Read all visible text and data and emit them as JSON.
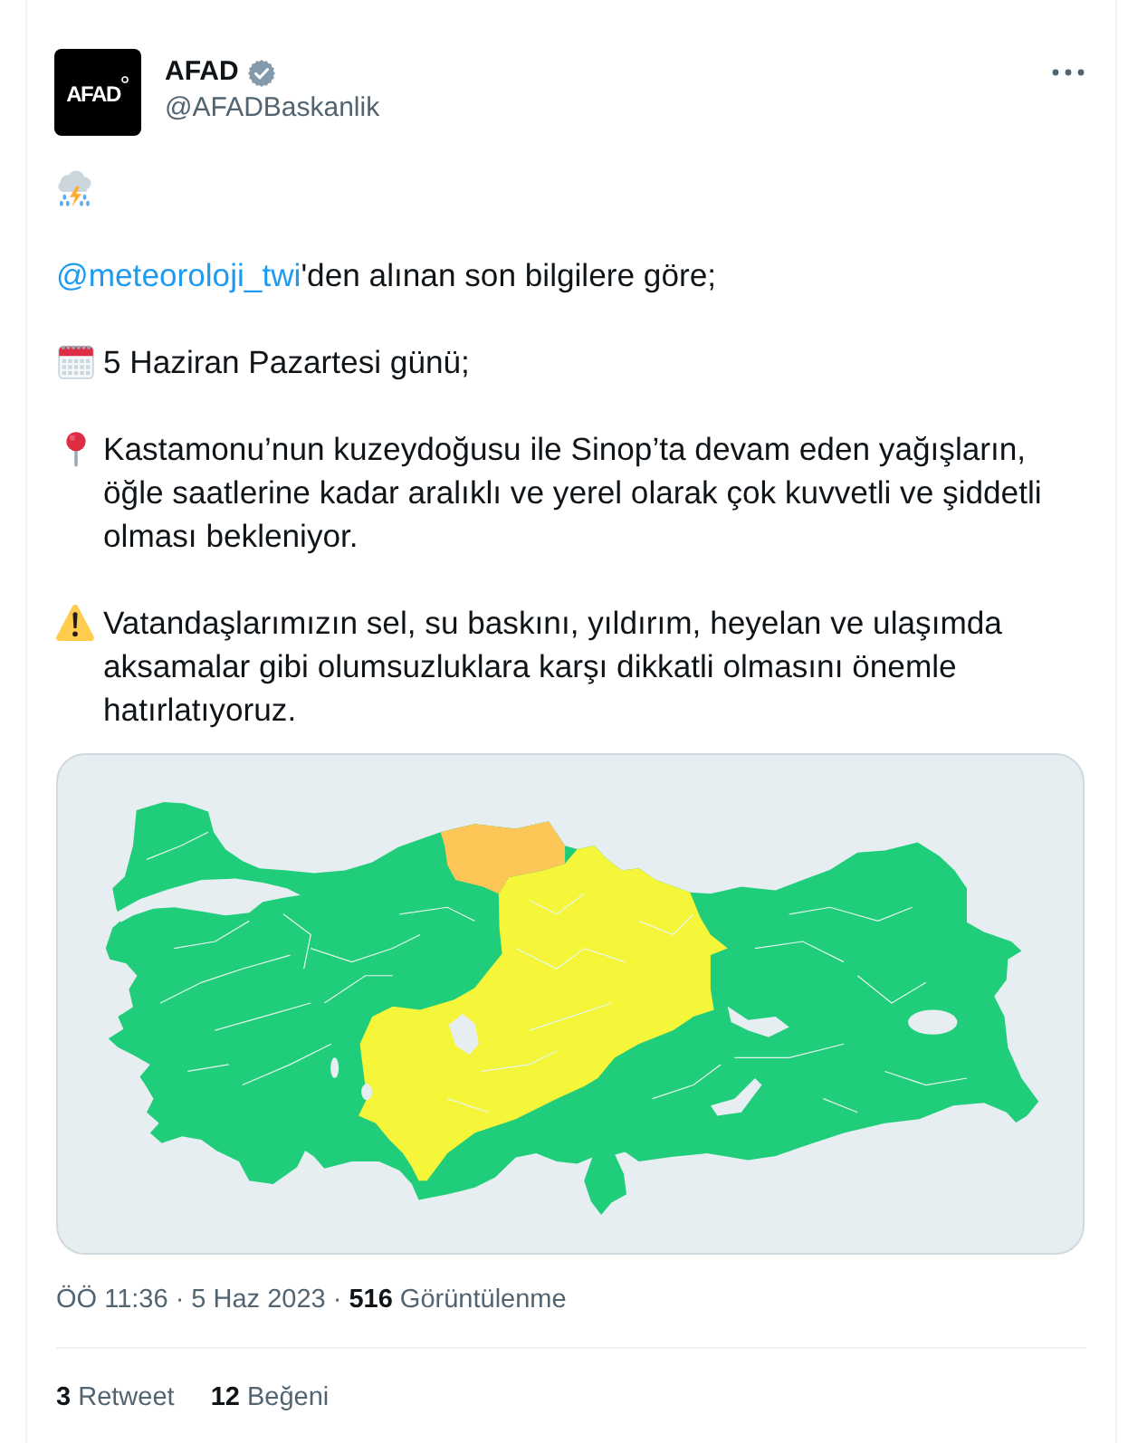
{
  "author": {
    "avatar_text": "AFAD",
    "name": "AFAD",
    "verified": true,
    "handle": "@AFADBaskanlik"
  },
  "paragraphs": [
    {
      "kind": "storm"
    },
    {
      "kind": "mention",
      "link": "@meteoroloji_twi",
      "text": "'den alınan son bilgilere göre;"
    },
    {
      "kind": "date",
      "text": "5 Haziran Pazartesi günü;"
    },
    {
      "kind": "pin",
      "text": "Kastamonu’nun kuzeydoğusu ile Sinop’ta devam eden yağışların, öğle saatlerine kadar aralıklı ve yerel olarak çok kuvvetli ve şiddetli olması bekleniyor."
    },
    {
      "kind": "warning",
      "text": "Vatandaşlarımızın sel, su baskını, yıldırım, heyelan ve ulaşımda aksamalar gibi olumsuzluklara karşı dikkatli olmasını önemle hatırlatıyoruz."
    }
  ],
  "meta": {
    "timestamp": "ÖÖ 11:36 · 5 Haz 2023",
    "separator": "·",
    "views": "**516** Görüntülenme"
  },
  "stats": [
    {
      "text": "**3** Retweet"
    },
    {
      "text": "**12** Beğeni"
    }
  ]
}
